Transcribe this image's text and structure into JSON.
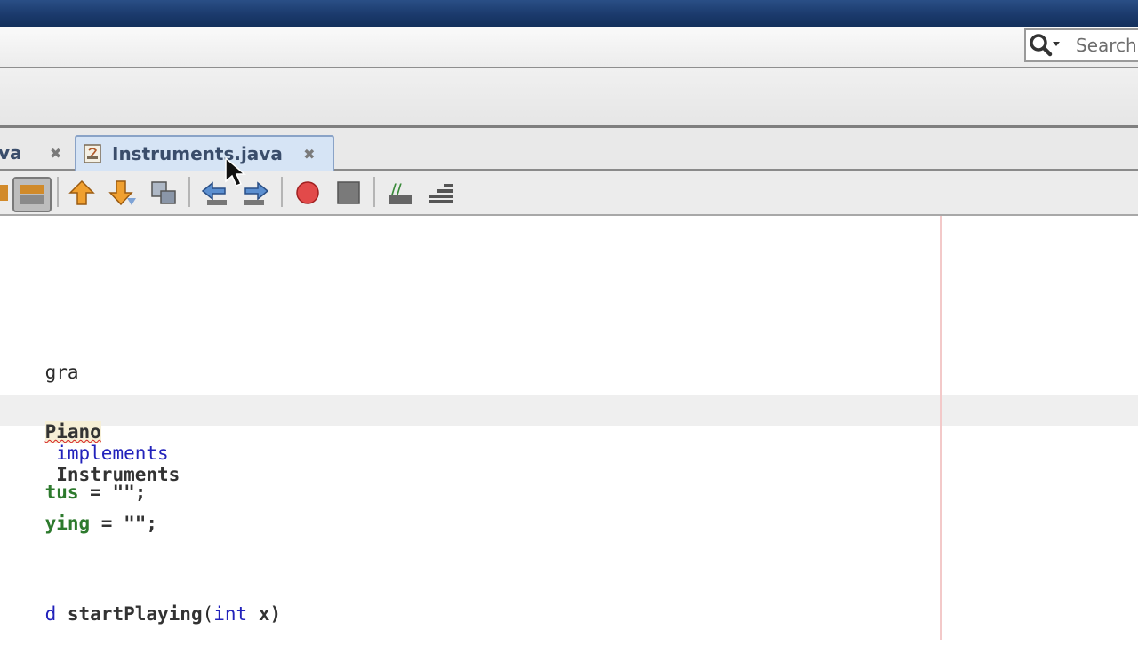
{
  "search": {
    "label": "Search"
  },
  "tabs": [
    {
      "label": "va",
      "active": false
    },
    {
      "label": "Instruments.java",
      "active": true
    }
  ],
  "editor_toolbar": {
    "icons": [
      "toggle-bookmark-icon",
      "previous-bookmark-icon",
      "next-bookmark-icon",
      "find-selection-icon",
      "shift-left-icon",
      "shift-right-icon",
      "start-macro-icon",
      "stop-macro-icon",
      "comment-icon",
      "uncomment-icon"
    ]
  },
  "code": {
    "line1": "gra",
    "line2_class": "Piano",
    "line2_kw": "implements",
    "line2_iface": "Instruments",
    "line3_field": "tus",
    "line3_rest": " = \"\";",
    "line4_field": "ying",
    "line4_rest": " = \"\";",
    "line5_prefix": "d ",
    "line5_method": "startPlaying",
    "line5_params_open": "(",
    "line5_params_kw": "int",
    "line5_params_rest": " x)"
  },
  "colors": {
    "keyword": "#2222bb",
    "field": "#2d7a2d",
    "title_bar": "#1b3a6c"
  }
}
